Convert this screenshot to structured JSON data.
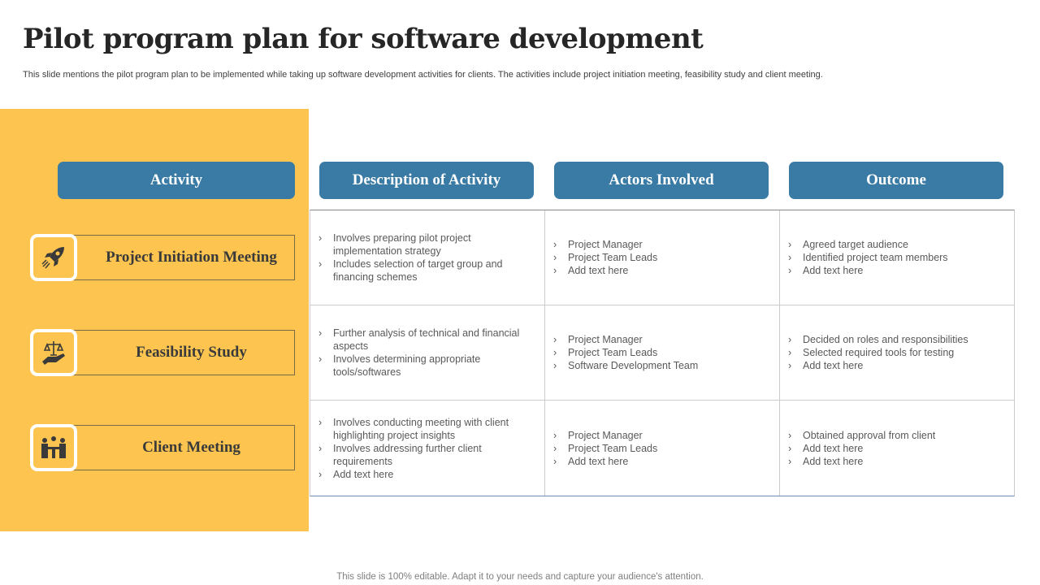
{
  "title": "Pilot program plan for software development",
  "subtitle": "This slide mentions the pilot program plan to be implemented while taking up software development activities for clients. The activities include project initiation meeting, feasibility study and client meeting.",
  "headers": [
    "Activity",
    "Description of Activity",
    "Actors Involved",
    "Outcome"
  ],
  "rows": [
    {
      "activity": "Project Initiation Meeting",
      "icon": "rocket-icon",
      "description": [
        "Involves preparing pilot project implementation strategy",
        "Includes selection of target group and financing schemes"
      ],
      "actors": [
        "Project Manager",
        "Project Team Leads",
        "Add text here"
      ],
      "outcome": [
        "Agreed target audience",
        "Identified project team members",
        "Add text here"
      ]
    },
    {
      "activity": "Feasibility Study",
      "icon": "scale-hand-icon",
      "description": [
        "Further analysis of technical and financial aspects",
        "Involves determining appropriate tools/softwares"
      ],
      "actors": [
        "Project Manager",
        "Project Team Leads",
        "Software Development Team"
      ],
      "outcome": [
        "Decided on roles and responsibilities",
        "Selected required tools for testing",
        "Add text here"
      ]
    },
    {
      "activity": "Client Meeting",
      "icon": "meeting-icon",
      "description": [
        "Involves conducting meeting with client highlighting project insights",
        "Involves addressing further client requirements",
        "Add text here"
      ],
      "actors": [
        "Project Manager",
        "Project Team Leads",
        "Add text here"
      ],
      "outcome": [
        "Obtained approval from client",
        "Add text here",
        "Add text here"
      ]
    }
  ],
  "footer": "This slide is 100% editable. Adapt it to your needs and capture your audience's attention.",
  "colors": {
    "panel": "#FDC54F",
    "header": "#3A7BA6"
  }
}
